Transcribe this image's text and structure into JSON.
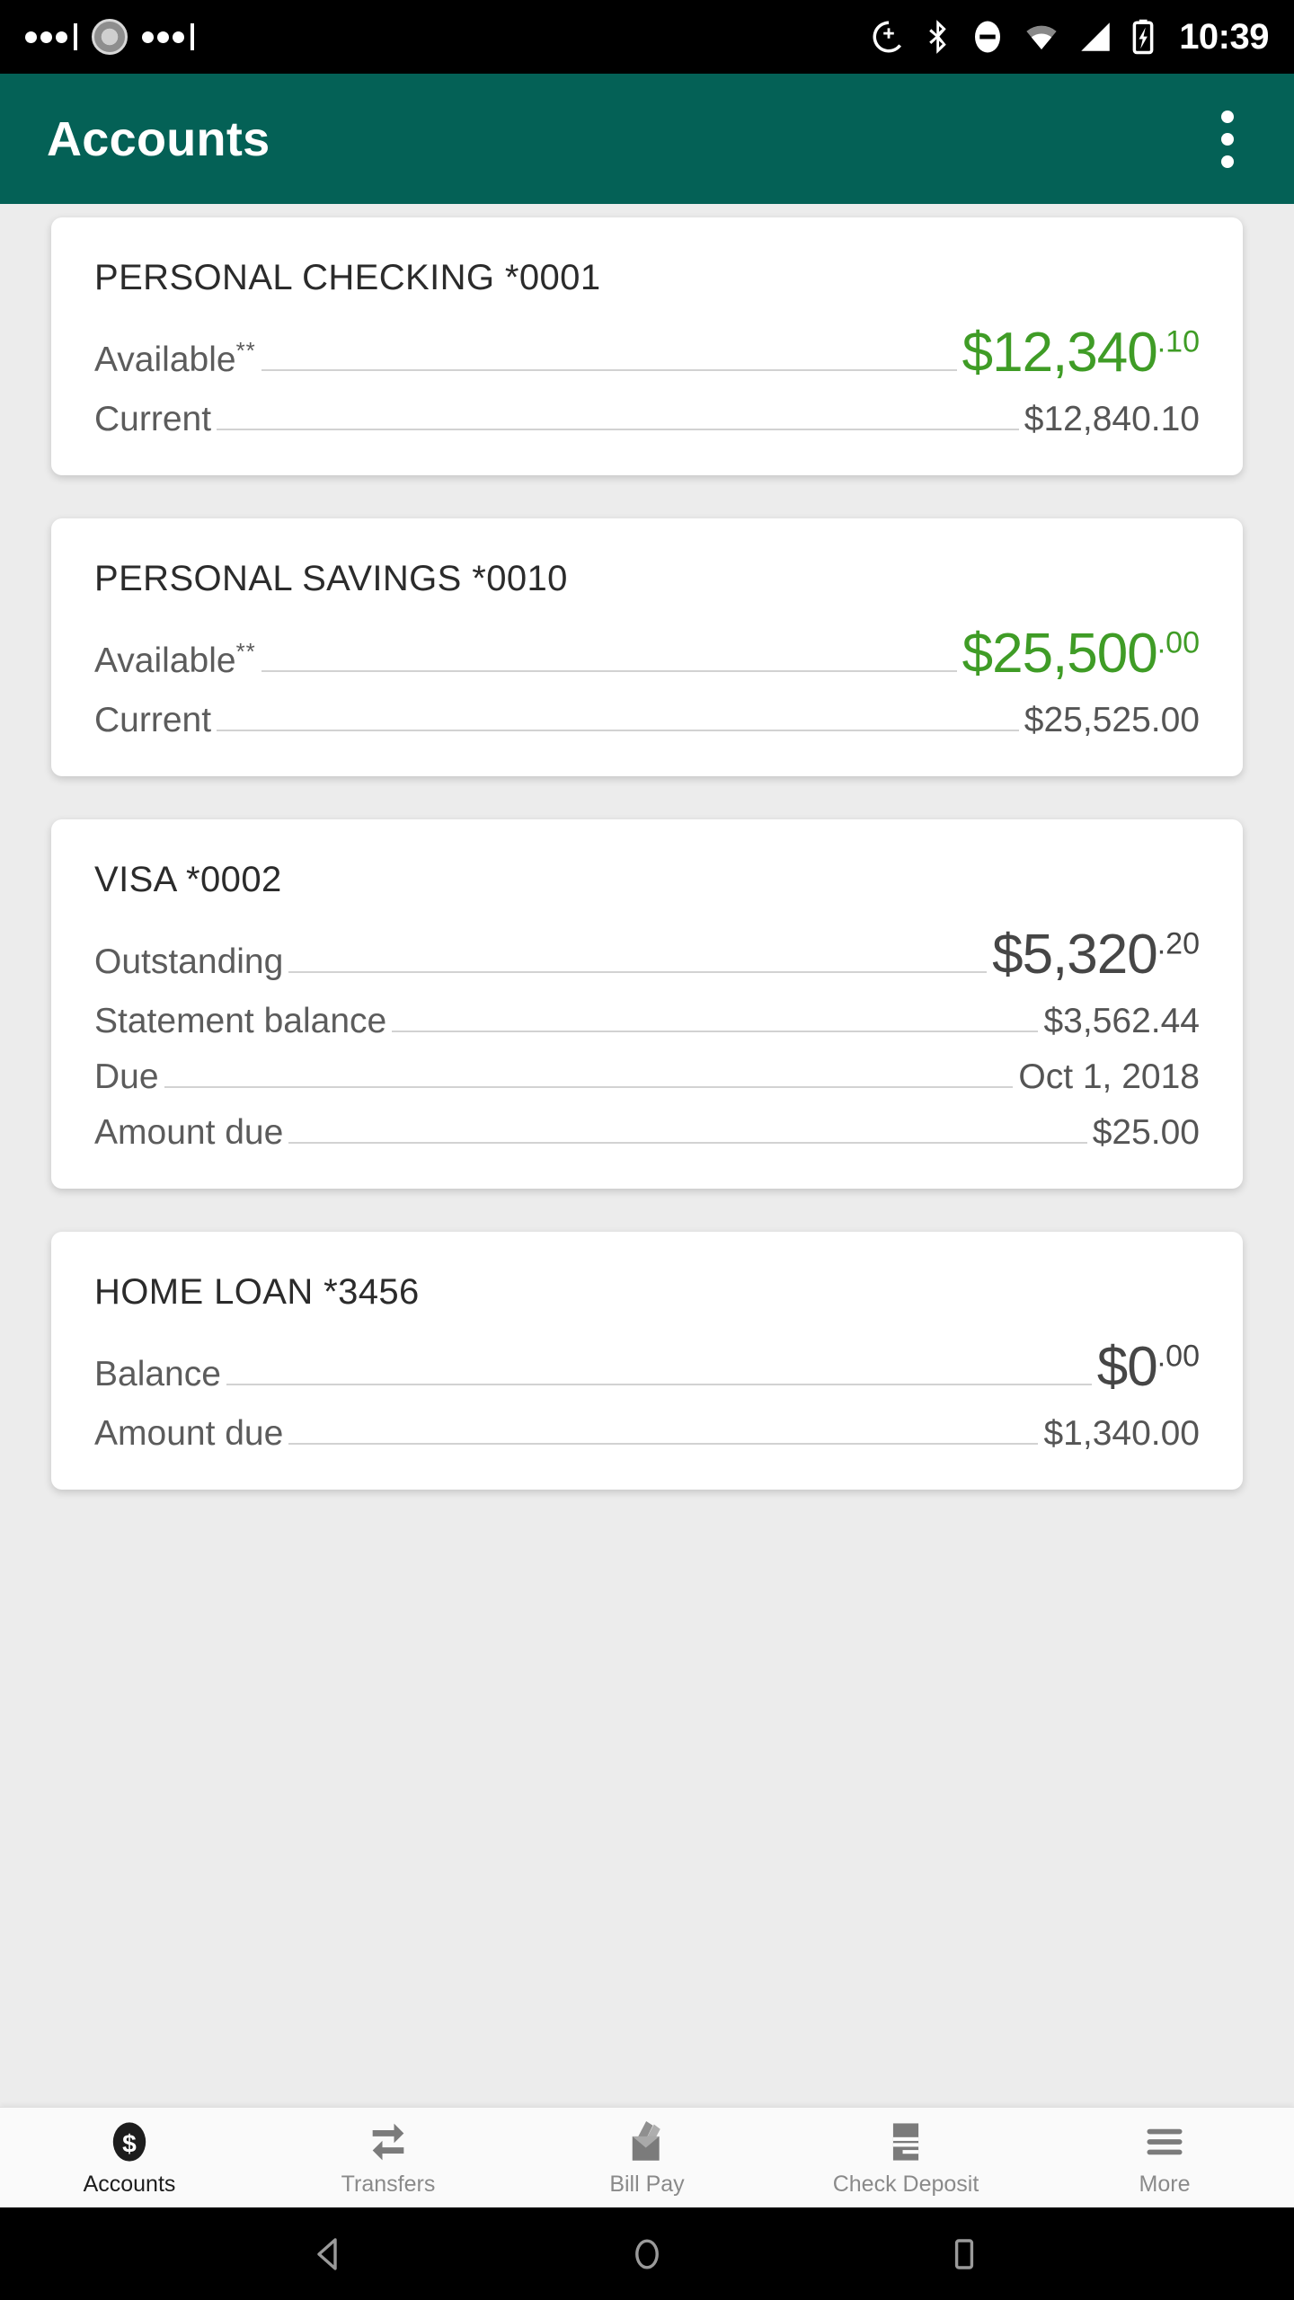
{
  "status_bar": {
    "time": "10:39",
    "left_icons": [
      "notification-dots-icon",
      "settings-gear-icon",
      "notification-dots-icon"
    ],
    "right_icons": [
      "gps-location-icon",
      "bluetooth-icon",
      "do-not-disturb-icon",
      "wifi-icon",
      "cell-signal-icon",
      "battery-charging-icon"
    ]
  },
  "app_bar": {
    "title": "Accounts",
    "overflow_label": "More options",
    "background_color": "#046156"
  },
  "colors": {
    "accent_green": "#3f9c26",
    "header_teal": "#046156",
    "value_gray": "#555555"
  },
  "accounts": [
    {
      "title": "PERSONAL CHECKING *0001",
      "rows": [
        {
          "label": "Available",
          "footnote": "**",
          "amount": "$12,340",
          "cents": ".10",
          "hero": true,
          "color": "green"
        },
        {
          "label": "Current",
          "value": "$12,840.10"
        }
      ]
    },
    {
      "title": "PERSONAL SAVINGS *0010",
      "rows": [
        {
          "label": "Available",
          "footnote": "**",
          "amount": "$25,500",
          "cents": ".00",
          "hero": true,
          "color": "green"
        },
        {
          "label": "Current",
          "value": "$25,525.00"
        }
      ]
    },
    {
      "title": "VISA *0002",
      "rows": [
        {
          "label": "Outstanding",
          "amount": "$5,320",
          "cents": ".20",
          "hero": true,
          "color": "dark"
        },
        {
          "label": "Statement balance",
          "value": "$3,562.44"
        },
        {
          "label": "Due",
          "value": "Oct 1, 2018"
        },
        {
          "label": "Amount due",
          "value": "$25.00"
        }
      ]
    },
    {
      "title": "HOME LOAN *3456",
      "rows": [
        {
          "label": "Balance",
          "amount": "$0",
          "cents": ".00",
          "hero": true,
          "color": "dark"
        },
        {
          "label": "Amount due",
          "value": "$1,340.00"
        }
      ]
    }
  ],
  "tab_bar": {
    "active_index": 0,
    "items": [
      {
        "label": "Accounts",
        "icon": "dollar-coin-icon"
      },
      {
        "label": "Transfers",
        "icon": "transfer-arrows-icon"
      },
      {
        "label": "Bill Pay",
        "icon": "envelope-check-icon"
      },
      {
        "label": "Check Deposit",
        "icon": "check-document-icon"
      },
      {
        "label": "More",
        "icon": "hamburger-menu-icon"
      }
    ]
  },
  "android_nav": {
    "back": "back-triangle-icon",
    "home": "home-circle-icon",
    "recents": "recents-square-icon"
  }
}
